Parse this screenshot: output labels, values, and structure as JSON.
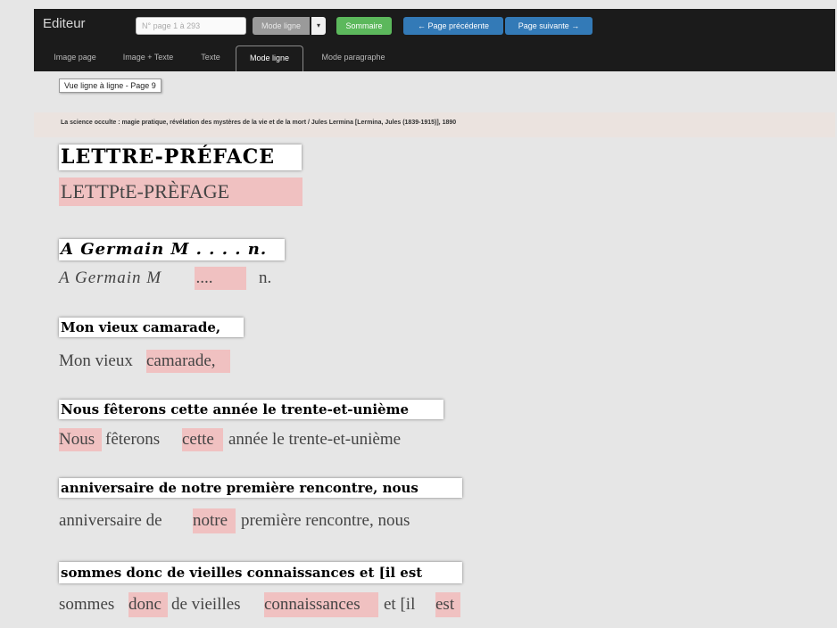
{
  "navbar": {
    "brand": "Editeur",
    "page_input_placeholder": "N° page 1 à 293",
    "mode_select_value": "Mode ligne",
    "summary_button": "Sommaire",
    "prev_button": "← Page précédente",
    "next_button": "Page suivante →"
  },
  "tabs": [
    "Image page",
    "Image + Texte",
    "Texte",
    "Mode ligne",
    "Mode paragraphe"
  ],
  "active_tab": "Mode ligne",
  "view_label": "Vue ligne à ligne - Page 9",
  "document_title": "La science occulte : magie pratique, révélation des mystères de la vie et de la mort / Jules Lermina [Lermina, Jules (1839-1915)], 1890",
  "lines": [
    {
      "scan": "LETTRE-PRÉFACE",
      "ocr": [
        {
          "t": "LETTPtE-PRÈFAGE",
          "hl": true
        }
      ]
    },
    {
      "scan": "A Germain M . . . . n.",
      "ocr": [
        {
          "t": "A Germain M"
        },
        {
          "t": "....",
          "hl": true
        },
        {
          "t": "n."
        }
      ]
    },
    {
      "scan": "Mon vieux camarade,",
      "ocr": [
        {
          "t": "Mon vieux"
        },
        {
          "t": "camarade,",
          "hl": true
        }
      ]
    },
    {
      "scan": "Nous fêterons cette année le trente-et-unième",
      "ocr": [
        {
          "t": "Nous",
          "hl": true
        },
        {
          "t": "fêterons"
        },
        {
          "t": "cette",
          "hl": true
        },
        {
          "t": "année le trente-et-unième"
        }
      ]
    },
    {
      "scan": "anniversaire de notre première rencontre, nous",
      "ocr": [
        {
          "t": "anniversaire de"
        },
        {
          "t": "notre",
          "hl": true
        },
        {
          "t": "première rencontre, nous"
        }
      ]
    },
    {
      "scan": "sommes donc de vieilles connaissances et [il est",
      "ocr": [
        {
          "t": "sommes"
        },
        {
          "t": "donc",
          "hl": true
        },
        {
          "t": "de vieilles"
        },
        {
          "t": "connaissances",
          "hl": true
        },
        {
          "t": "et [il"
        },
        {
          "t": "est",
          "hl": true
        }
      ]
    }
  ]
}
